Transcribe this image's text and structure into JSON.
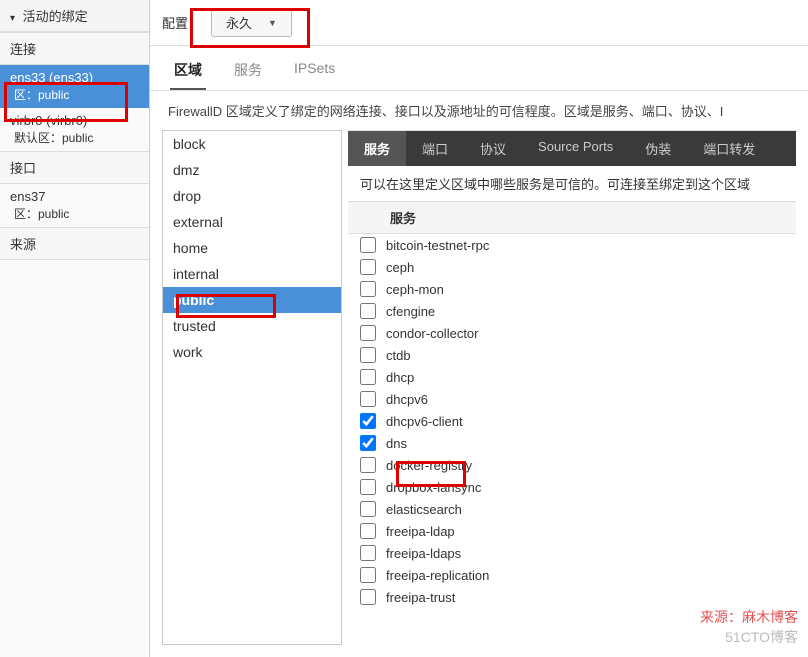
{
  "left": {
    "active_binding_header": "活动的绑定",
    "connections_label": "连接",
    "connections": [
      {
        "name": "ens33 (ens33)",
        "zone": "区：public",
        "selected": true
      },
      {
        "name": "virbr0 (virbr0)",
        "zone": "默认区：public",
        "selected": false
      }
    ],
    "interfaces_label": "接口",
    "interfaces": [
      {
        "name": "ens37",
        "zone": "区：public"
      }
    ],
    "sources_label": "来源"
  },
  "config": {
    "label": "配置：",
    "dropdown_value": "永久"
  },
  "tabs": {
    "items": [
      {
        "label": "区域",
        "active": true
      },
      {
        "label": "服务",
        "active": false
      },
      {
        "label": "IPSets",
        "active": false
      }
    ]
  },
  "description": "FirewallD 区域定义了绑定的网络连接、接口以及源地址的可信程度。区域是服务、端口、协议、I",
  "zones": [
    "block",
    "dmz",
    "drop",
    "external",
    "home",
    "internal",
    "public",
    "trusted",
    "work"
  ],
  "zone_selected": "public",
  "sub_tabs": [
    {
      "label": "服务",
      "active": true
    },
    {
      "label": "端口",
      "active": false
    },
    {
      "label": "协议",
      "active": false
    },
    {
      "label": "Source Ports",
      "active": false
    },
    {
      "label": "伪装",
      "active": false
    },
    {
      "label": "端口转发",
      "active": false
    }
  ],
  "sub_description": "可以在这里定义区域中哪些服务是可信的。可连接至绑定到这个区域",
  "services_header": "服务",
  "services": [
    {
      "name": "bitcoin-testnet-rpc",
      "checked": false
    },
    {
      "name": "ceph",
      "checked": false
    },
    {
      "name": "ceph-mon",
      "checked": false
    },
    {
      "name": "cfengine",
      "checked": false
    },
    {
      "name": "condor-collector",
      "checked": false
    },
    {
      "name": "ctdb",
      "checked": false
    },
    {
      "name": "dhcp",
      "checked": false
    },
    {
      "name": "dhcpv6",
      "checked": false
    },
    {
      "name": "dhcpv6-client",
      "checked": true
    },
    {
      "name": "dns",
      "checked": true
    },
    {
      "name": "docker-registry",
      "checked": false
    },
    {
      "name": "dropbox-lansync",
      "checked": false
    },
    {
      "name": "elasticsearch",
      "checked": false
    },
    {
      "name": "freeipa-ldap",
      "checked": false
    },
    {
      "name": "freeipa-ldaps",
      "checked": false
    },
    {
      "name": "freeipa-replication",
      "checked": false
    },
    {
      "name": "freeipa-trust",
      "checked": false
    }
  ],
  "watermark": "来源：麻木博客",
  "watermark2": "51CTO博客"
}
